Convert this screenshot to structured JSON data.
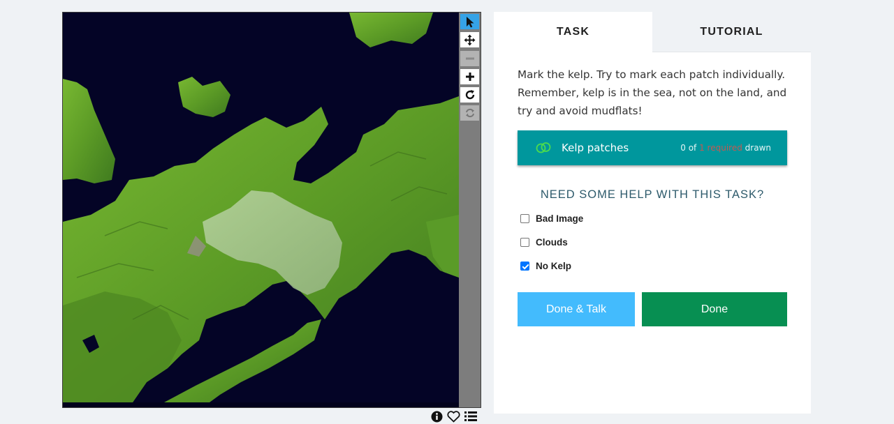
{
  "viewer": {
    "image_alt": "Satellite image of coastline",
    "tools": [
      {
        "name": "annotate",
        "icon": "pointer-arrow-icon",
        "state": "active"
      },
      {
        "name": "pan",
        "icon": "move-icon",
        "state": "normal"
      },
      {
        "name": "zoom-out",
        "icon": "minus-icon",
        "state": "disabled"
      },
      {
        "name": "zoom-in",
        "icon": "plus-icon",
        "state": "normal"
      },
      {
        "name": "rotate",
        "icon": "rotate-icon",
        "state": "normal"
      },
      {
        "name": "reset",
        "icon": "reset-icon",
        "state": "disabled"
      }
    ],
    "footer_icons": [
      "info-icon",
      "heart-icon",
      "list-icon"
    ]
  },
  "panel": {
    "tabs": [
      {
        "label": "TASK",
        "active": true
      },
      {
        "label": "TUTORIAL",
        "active": false
      }
    ],
    "instruction": "Mark the kelp. Try to mark each patch individually. Remember, kelp is in the sea, not on the land, and try and avoid mudflats!",
    "drawing_tool": {
      "label": "Kelp patches",
      "count_prefix": "0 of",
      "count_required": "1 required",
      "count_suffix": "drawn",
      "icon": "two-circles-icon",
      "color": "#00979d"
    },
    "help_title": "NEED SOME HELP WITH THIS TASK?",
    "options": [
      {
        "label": "Bad Image",
        "checked": false
      },
      {
        "label": "Clouds",
        "checked": false
      },
      {
        "label": "No Kelp",
        "checked": true
      }
    ],
    "buttons": {
      "talk_label": "Done & Talk",
      "done_label": "Done"
    }
  },
  "colors": {
    "page_bg": "#eff2f5",
    "tool_active": "#35a3e7",
    "talk_button": "#43bbfd",
    "done_button": "#078f52",
    "water": "#040426",
    "land": "#5fa32a"
  }
}
